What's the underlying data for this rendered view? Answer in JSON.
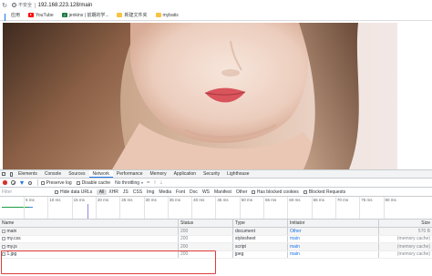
{
  "browser": {
    "security_label": "不安全",
    "url": "192.168.223.128/main"
  },
  "bookmarks": [
    {
      "label": "应用",
      "icon": "apps-grid-icon"
    },
    {
      "label": "YouTube",
      "icon": "youtube-icon"
    },
    {
      "label": "jenkins | 前期的学...",
      "icon": "jenkins-icon"
    },
    {
      "label": "新建文件夹",
      "icon": "folder-icon"
    },
    {
      "label": "mybatis",
      "icon": "folder-icon"
    }
  ],
  "devtools": {
    "tabs": [
      "Elements",
      "Console",
      "Sources",
      "Network",
      "Performance",
      "Memory",
      "Application",
      "Security",
      "Lighthouse"
    ],
    "active_tab": "Network",
    "toolbar": {
      "preserve_log": "Preserve log",
      "disable_cache": "Disable cache",
      "throttling": "No throttling"
    },
    "filter": {
      "placeholder": "Filter",
      "hide_data_urls": "Hide data URLs",
      "types": [
        "All",
        "XHR",
        "JS",
        "CSS",
        "Img",
        "Media",
        "Font",
        "Doc",
        "WS",
        "Manifest",
        "Other"
      ],
      "has_blocked_cookies": "Has blocked cookies",
      "blocked_requests": "Blocked Requests"
    },
    "timeline_ticks": [
      "5 ms",
      "10 ms",
      "15 ms",
      "20 ms",
      "25 ms",
      "30 ms",
      "35 ms",
      "40 ms",
      "45 ms",
      "50 ms",
      "55 ms",
      "60 ms",
      "65 ms",
      "70 ms",
      "75 ms",
      "80 ms"
    ],
    "table": {
      "headers": {
        "name": "Name",
        "status": "Status",
        "type": "Type",
        "initiator": "Initiator",
        "size": "Size"
      },
      "rows": [
        {
          "name": "main",
          "status": "200",
          "type": "document",
          "initiator": "Other",
          "size": "570 B"
        },
        {
          "name": "my.css",
          "status": "200",
          "type": "stylesheet",
          "initiator": "main",
          "size": "(memory cache)"
        },
        {
          "name": "my.js",
          "status": "200",
          "type": "script",
          "initiator": "main",
          "size": "(memory cache)"
        },
        {
          "name": "1.jpg",
          "status": "200",
          "type": "jpeg",
          "initiator": "main",
          "size": "(memory cache)"
        }
      ]
    }
  },
  "colors": {
    "accent": "#1a73e8",
    "record": "#d93025",
    "highlight_box": "#e23b3b"
  }
}
